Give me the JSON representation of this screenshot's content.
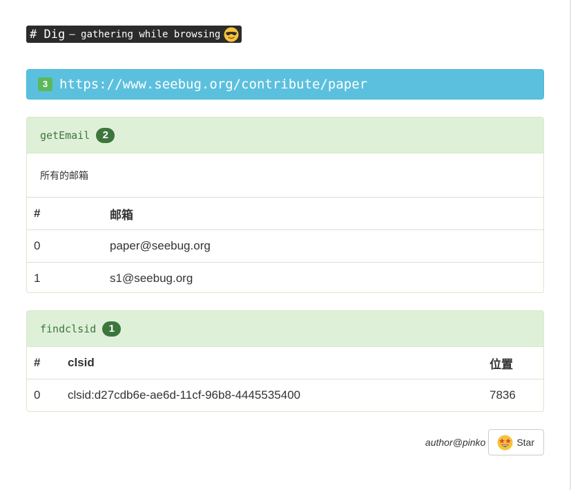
{
  "header": {
    "title": "# Dig",
    "subtitle": "– gathering while browsing",
    "emoji": "sunglasses-emoji"
  },
  "url_bar": {
    "count": "3",
    "url": "https://www.seebug.org/contribute/paper",
    "color": "#5bc0de"
  },
  "panels": [
    {
      "title": "getEmail",
      "count": "2",
      "description": "所有的邮箱",
      "columns": [
        "#",
        "邮箱"
      ],
      "rows": [
        [
          "0",
          "paper@seebug.org"
        ],
        [
          "1",
          "s1@seebug.org"
        ]
      ]
    },
    {
      "title": "findclsid",
      "count": "1",
      "columns": [
        "#",
        "clsid",
        "位置"
      ],
      "rows": [
        [
          "0",
          "clsid:d27cdb6e-ae6d-11cf-96b8-4445535400",
          "7836"
        ]
      ]
    }
  ],
  "footer": {
    "author": "author@pinko",
    "star_label": "Star",
    "star_emoji": "star-struck-emoji"
  },
  "colors": {
    "panel_heading_bg": "#dff0d8",
    "panel_heading_text": "#3c763d",
    "badge_green": "#5cb85c"
  }
}
